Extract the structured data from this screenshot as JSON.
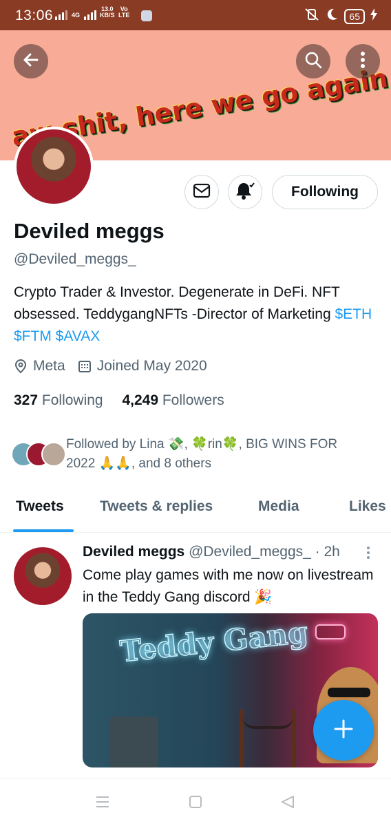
{
  "status_bar": {
    "time": "13:06",
    "network": "4G",
    "speed_value": "13.0",
    "speed_unit": "KB/S",
    "carrier_top": "Vo",
    "carrier_bottom": "LTE",
    "battery": "65"
  },
  "banner": {
    "text": "aw shit, here we go again",
    "background_color": "#f8ab97"
  },
  "profile": {
    "name": "Deviled meggs",
    "handle": "@Deviled_meggs_",
    "bio_text": "Crypto Trader & Investor. Degenerate in DeFi. NFT obsessed. TeddygangNFTs -Director of Marketing ",
    "bio_cashtags": "$ETH $FTM $AVAX",
    "location": "Meta",
    "joined": "Joined May 2020",
    "following_count": "327",
    "following_label": "Following",
    "followers_count": "4,249",
    "followers_label": "Followers",
    "follow_button_label": "Following",
    "followed_by": "Followed by Lina 💸, 🍀rin🍀, BIG WINS FOR 2022 🙏🙏, and 8 others"
  },
  "tabs": [
    {
      "label": "Tweets",
      "active": true
    },
    {
      "label": "Tweets & replies",
      "active": false
    },
    {
      "label": "Media",
      "active": false
    },
    {
      "label": "Likes",
      "active": false
    }
  ],
  "tweet": {
    "author_name": "Deviled meggs",
    "author_handle": "@Deviled_meggs_",
    "time": "· 2h",
    "text": "Come play games with me now on livestream in the Teddy Gang discord 🎉",
    "media_sign": "Teddy Gang"
  },
  "colors": {
    "accent": "#1d9bf0",
    "status_bar": "#8a3b24",
    "secondary_text": "#536471"
  },
  "icons": [
    "back-arrow-icon",
    "search-icon",
    "more-vertical-icon",
    "mail-icon",
    "bell-icon",
    "location-icon",
    "calendar-icon",
    "plus-icon",
    "menu-icon",
    "home-square-icon",
    "back-triangle-icon"
  ]
}
